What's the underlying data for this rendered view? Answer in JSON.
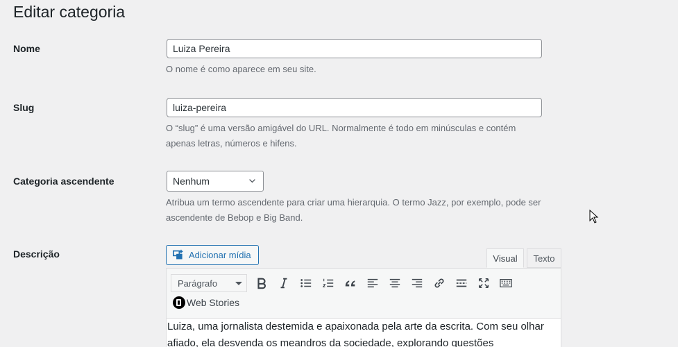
{
  "page": {
    "title": "Editar categoria"
  },
  "fields": {
    "name": {
      "label": "Nome",
      "value": "Luiza Pereira",
      "help": "O nome é como aparece em seu site."
    },
    "slug": {
      "label": "Slug",
      "value": "luiza-pereira",
      "help": "O “slug” é uma versão amigável do URL. Normalmente é todo em minúsculas e contém apenas letras, números e hifens."
    },
    "parent": {
      "label": "Categoria ascendente",
      "selected": "Nenhum",
      "help": "Atribua um termo ascendente para criar uma hierarquia. O termo Jazz, por exemplo, pode ser ascendente de Bebop e Big Band."
    },
    "description": {
      "label": "Descrição",
      "add_media_label": "Adicionar mídia",
      "tabs": {
        "visual": "Visual",
        "text": "Texto"
      },
      "format_select": "Parágrafo",
      "web_stories_label": "Web Stories",
      "content": "Luiza, uma jornalista destemida e apaixonada pela arte da escrita. Com seu olhar afiado, ela desvenda os meandros da sociedade, explorando questões"
    }
  },
  "toolbar_icons": [
    "bold-icon",
    "italic-icon",
    "bullet-list-icon",
    "numbered-list-icon",
    "blockquote-icon",
    "align-left-icon",
    "align-center-icon",
    "align-right-icon",
    "link-icon",
    "read-more-icon",
    "fullscreen-icon",
    "toolbar-toggle-icon"
  ],
  "colors": {
    "accent": "#2271b1",
    "help_text": "#646970",
    "background": "#f0f0f1"
  }
}
